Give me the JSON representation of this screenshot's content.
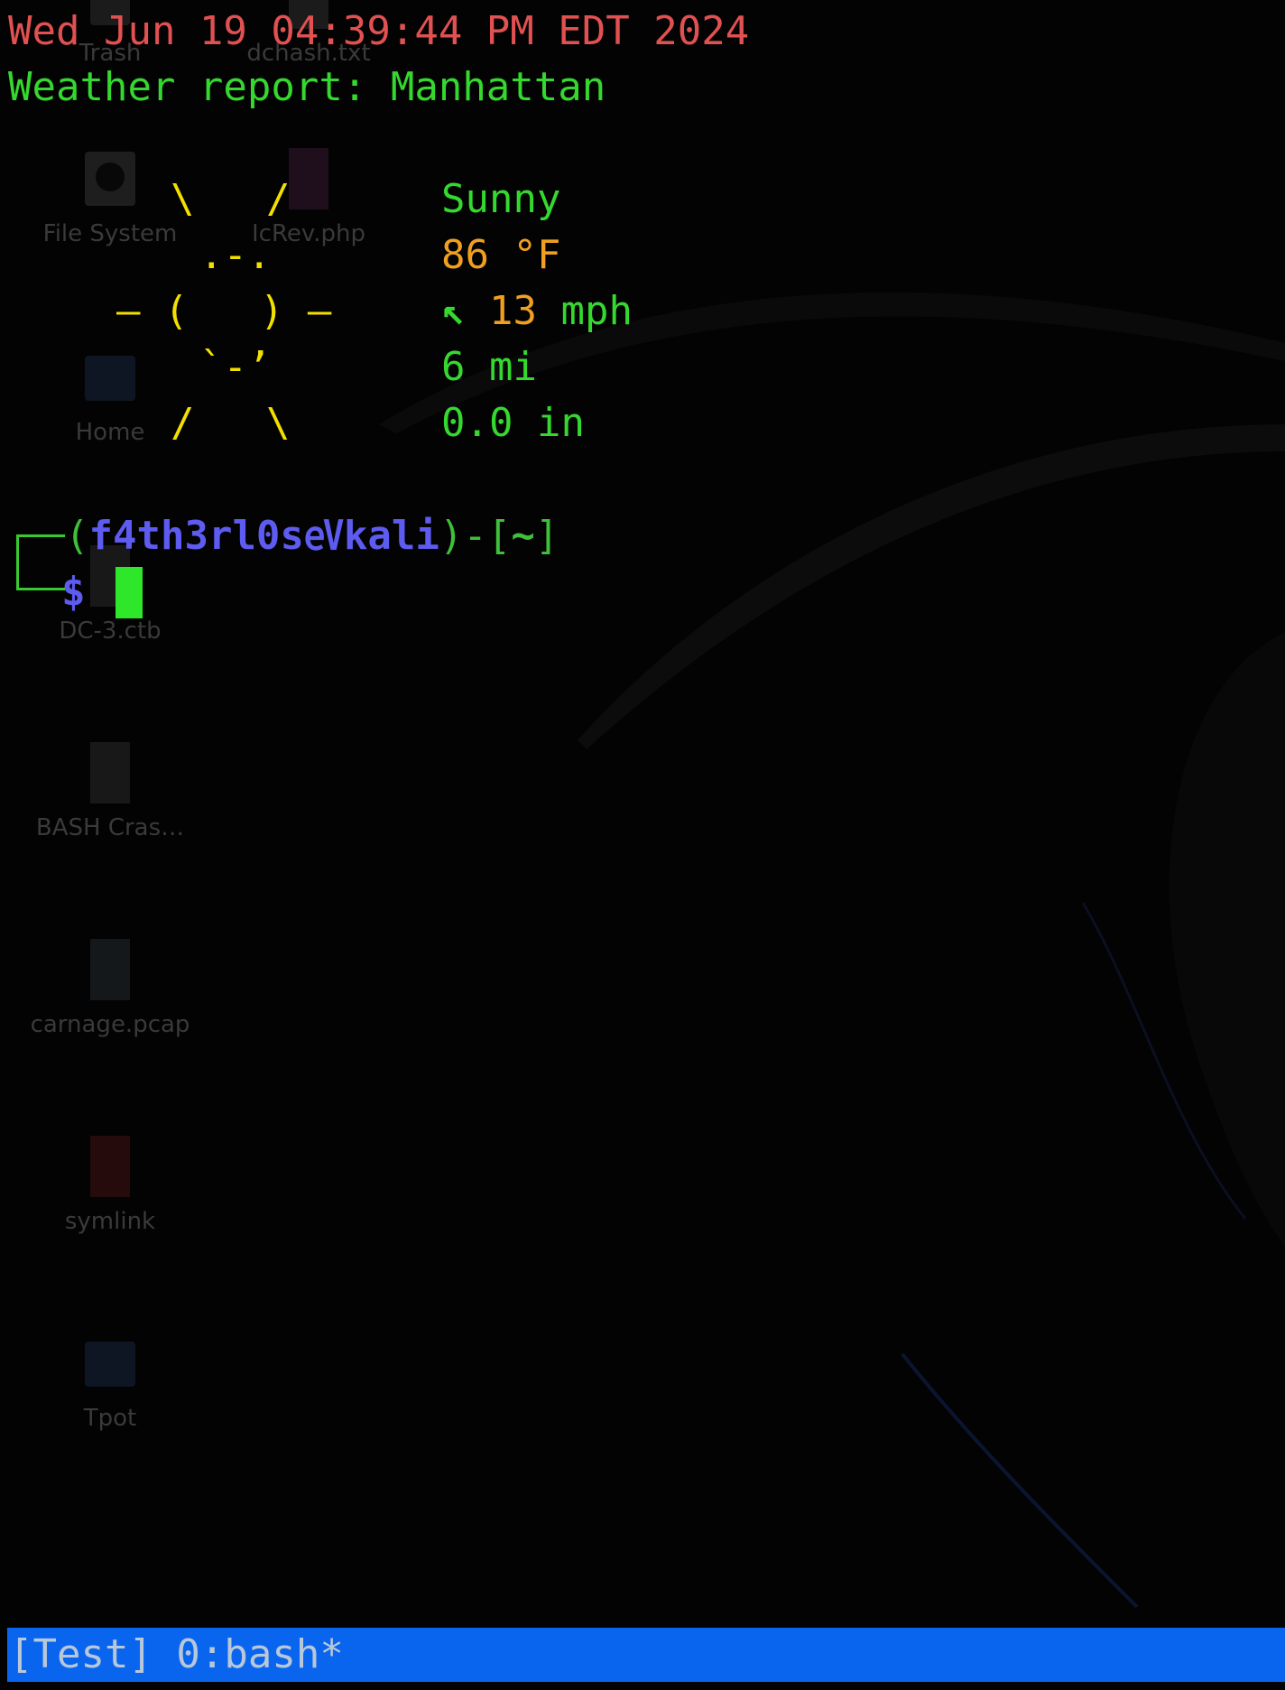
{
  "terminal": {
    "date_line": "Wed Jun 19 04:39:44 PM EDT 2024",
    "weather_header": "Weather report: Manhattan",
    "ascii_sun": {
      "line1": "\\   /",
      "line2": ".-.",
      "line3": "‒ (   ) ‒",
      "line4": "`-’",
      "line5": "/   \\"
    },
    "weather": {
      "condition": "Sunny",
      "temperature": "86",
      "temperature_unit": "°F",
      "wind_arrow": "↖",
      "wind_speed": "13",
      "wind_unit": "mph",
      "visibility": "6 mi",
      "precipitation": "0.0 in"
    },
    "prompt": {
      "open": "(",
      "user": "f4th3rl0s",
      "separator": "㋎",
      "host": "kali",
      "close": ")-[",
      "cwd": "~",
      "cwd_close": "]",
      "symbol": "$"
    }
  },
  "desktop": {
    "icons": [
      {
        "label": "Trash",
        "icon": "trash-icon"
      },
      {
        "label": "dchash.txt",
        "icon": "text-file-icon"
      },
      {
        "label": "File System",
        "icon": "drive-icon"
      },
      {
        "label": "IcRev.php",
        "icon": "php-file-icon"
      },
      {
        "label": "Home",
        "icon": "home-folder-icon"
      },
      {
        "label": "DC-3.ctb",
        "icon": "file-icon"
      },
      {
        "label": "BASH Cras…",
        "icon": "document-icon"
      },
      {
        "label": "carnage.pcap",
        "icon": "pcap-file-icon"
      },
      {
        "label": "symlink",
        "icon": "broken-link-icon"
      },
      {
        "label": "Tpot",
        "icon": "folder-icon"
      }
    ]
  },
  "tmux": {
    "status": "[Test] 0:bash*"
  },
  "colors": {
    "date": "#e25151",
    "green": "#35d82e",
    "sun": "#f3e000",
    "numbers": "#f0a020",
    "prompt_user": "#5d5bf0",
    "status_bar": "#0a65ee"
  }
}
